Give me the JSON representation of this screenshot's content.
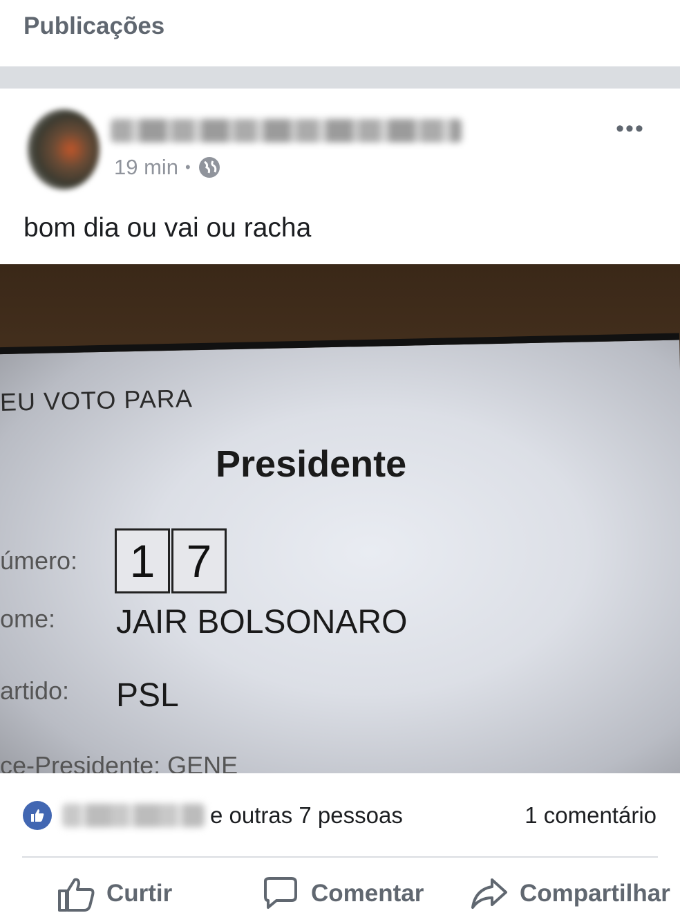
{
  "header": {
    "title": "Publicações"
  },
  "post": {
    "time": "19 min",
    "separator": "•",
    "text": "bom dia ou vai ou racha",
    "more_label": "•••",
    "photo": {
      "vote_label": "EU VOTO PARA",
      "office": "Presidente",
      "number_label": "úmero:",
      "digits": [
        "1",
        "7"
      ],
      "name_label": "ome:",
      "name_value": "JAIR BOLSONARO",
      "party_label": "artido:",
      "party_value": "PSL",
      "vice_label": "ce-Presidente: GENE"
    }
  },
  "reactions": {
    "others": "e outras 7 pessoas",
    "comments": "1 comentário"
  },
  "actions": {
    "like": "Curtir",
    "comment": "Comentar",
    "share": "Compartilhar"
  },
  "colors": {
    "accent": "#4267b2",
    "muted_text": "#606770",
    "divider": "#dadde1"
  },
  "icons": [
    "globe-icon",
    "more-icon",
    "like-badge-icon",
    "thumbs-up-icon",
    "comment-icon",
    "share-icon"
  ]
}
